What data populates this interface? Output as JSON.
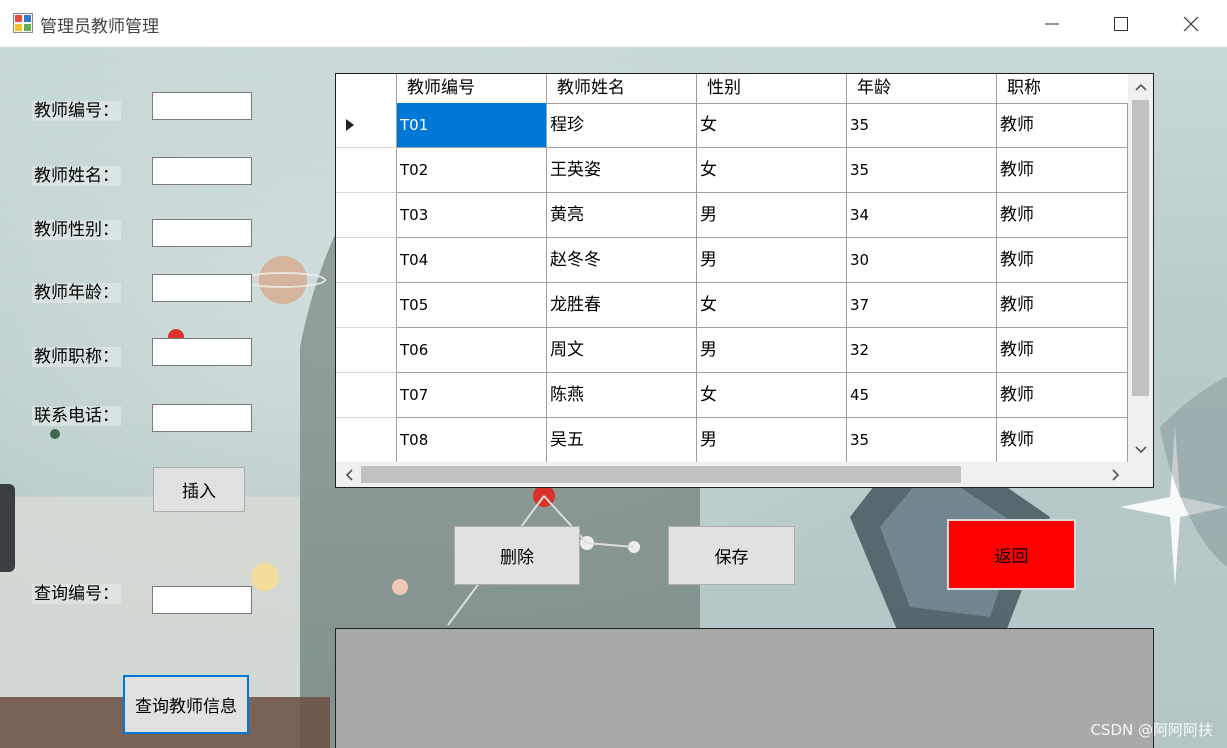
{
  "window": {
    "title": "管理员教师管理",
    "icons": {
      "app": "app-form-icon",
      "minimize": "minimize-icon",
      "maximize": "maximize-icon",
      "close": "close-icon"
    }
  },
  "form": {
    "teacher_id_label": "教师编号：",
    "teacher_name_label": "教师姓名：",
    "teacher_gender_label": "教师性别：",
    "teacher_age_label": "教师年龄：",
    "teacher_title_label": "教师职称：",
    "phone_label": "联系电话：",
    "teacher_id_value": "",
    "teacher_name_value": "",
    "teacher_gender_value": "",
    "teacher_age_value": "",
    "teacher_title_value": "",
    "phone_value": "",
    "insert_label": "插入",
    "query_id_label": "查询编号：",
    "query_id_value": "",
    "query_button_label": "查询教师信息"
  },
  "actions": {
    "delete_label": "删除",
    "save_label": "保存",
    "return_label": "返回",
    "return_color": "#ff0000"
  },
  "grid": {
    "columns": [
      "教师编号",
      "教师姓名",
      "性别",
      "年龄",
      "职称"
    ],
    "rows": [
      [
        "T01",
        "程珍",
        "女",
        "35",
        "教师"
      ],
      [
        "T02",
        "王英姿",
        "女",
        "35",
        "教师"
      ],
      [
        "T03",
        "黄亮",
        "男",
        "34",
        "教师"
      ],
      [
        "T04",
        "赵冬冬",
        "男",
        "30",
        "教师"
      ],
      [
        "T05",
        "龙胜春",
        "女",
        "37",
        "教师"
      ],
      [
        "T06",
        "周文",
        "男",
        "32",
        "教师"
      ],
      [
        "T07",
        "陈燕",
        "女",
        "45",
        "教师"
      ],
      [
        "T08",
        "吴五",
        "男",
        "35",
        "教师"
      ]
    ],
    "selected_row": 0,
    "selection_color": "#0078d7"
  },
  "watermark": "CSDN @阿阿阿扶"
}
